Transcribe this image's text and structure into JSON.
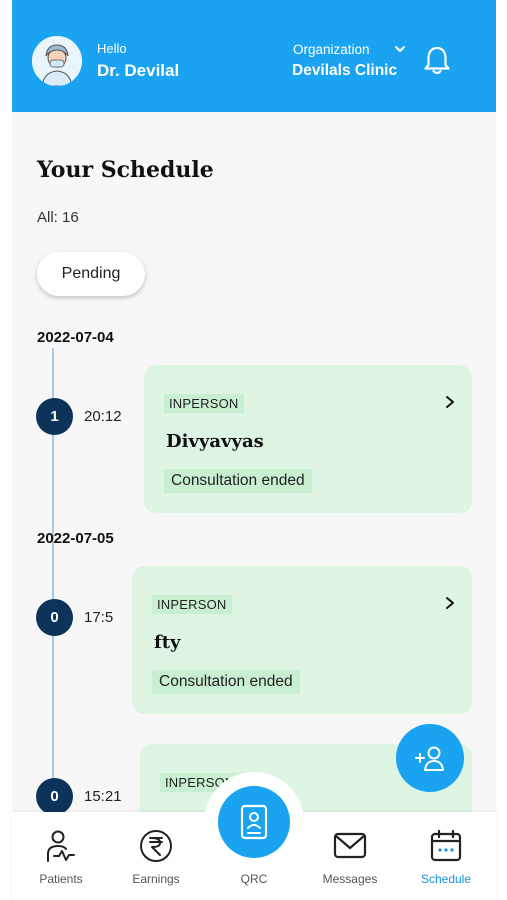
{
  "header": {
    "greeting": "Hello",
    "doctor_name": "Dr. Devilal",
    "org_label": "Organization",
    "org_name": "Devilals Clinic"
  },
  "schedule": {
    "title": "Your Schedule",
    "count_label": "All: 16",
    "filter_label": "Pending",
    "groups": [
      {
        "date": "2022-07-04",
        "appointments": [
          {
            "index": "1",
            "time": "20:12",
            "mode": "INPERSON",
            "patient": "Divyavyas",
            "status": "Consultation ended"
          }
        ]
      },
      {
        "date": "2022-07-05",
        "appointments": [
          {
            "index": "0",
            "time": "17:5",
            "mode": "INPERSON",
            "patient": "fty",
            "status": "Consultation ended"
          },
          {
            "index": "0",
            "time": "15:21",
            "mode": "INPERSON",
            "patient": "",
            "status": ""
          }
        ]
      }
    ]
  },
  "bottom_nav": {
    "items": [
      {
        "label": "Patients",
        "icon": "patients-icon"
      },
      {
        "label": "Earnings",
        "icon": "rupee-icon"
      },
      {
        "label": "QRC",
        "icon": "id-badge-icon"
      },
      {
        "label": "Messages",
        "icon": "mail-icon"
      },
      {
        "label": "Schedule",
        "icon": "calendar-icon",
        "active": true
      }
    ]
  },
  "colors": {
    "primary": "#1aa3f0",
    "card_bg": "#dff5e4",
    "tag_bg": "#c9efd2",
    "dot_bg": "#0e3358",
    "active_nav": "#1a8fd8"
  }
}
